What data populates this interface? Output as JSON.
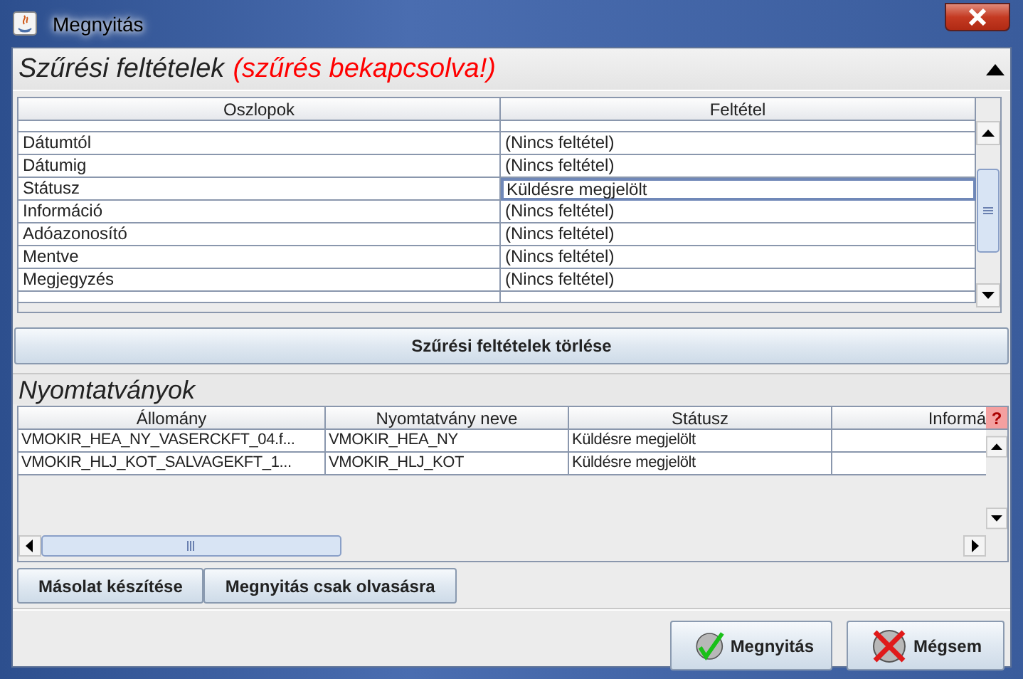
{
  "window": {
    "title": "Megnyitás"
  },
  "filter": {
    "title": "Szűrési feltételek",
    "status": "(szűrés bekapcsolva!)",
    "expanded": true,
    "columns": [
      "Oszlopok",
      "Feltétel"
    ],
    "rows": [
      {
        "column": "Dátumtól",
        "condition": "(Nincs feltétel)",
        "selected": false
      },
      {
        "column": "Dátumig",
        "condition": "(Nincs feltétel)",
        "selected": false
      },
      {
        "column": "Státusz",
        "condition": "Küldésre megjelölt",
        "selected": true
      },
      {
        "column": "Információ",
        "condition": "(Nincs feltétel)",
        "selected": false
      },
      {
        "column": "Adóazonosító",
        "condition": "(Nincs feltétel)",
        "selected": false
      },
      {
        "column": "Mentve",
        "condition": "(Nincs feltétel)",
        "selected": false
      },
      {
        "column": "Megjegyzés",
        "condition": "(Nincs feltétel)",
        "selected": false
      }
    ],
    "clear_button": "Szűrési feltételek törlése"
  },
  "forms": {
    "title": "Nyomtatványok",
    "columns": [
      "Állomány",
      "Nyomtatvány neve",
      "Státusz",
      "Informá"
    ],
    "help": "?",
    "rows": [
      {
        "cells": [
          "VMOKIR_HEA_NY_VASERCKFT_04.f...",
          "VMOKIR_HEA_NY",
          "Küldésre megjelölt"
        ]
      },
      {
        "cells": [
          "VMOKIR_HLJ_KOT_SALVAGEKFT_1...",
          "VMOKIR_HLJ_KOT",
          "Küldésre megjelölt"
        ]
      }
    ]
  },
  "actions": [
    "Másolat készítése",
    "Megnyitás csak olvasásra"
  ],
  "buttons": [
    {
      "label": "Megnyitás",
      "kind": "ok"
    },
    {
      "label": "Mégsem",
      "kind": "cancel"
    }
  ]
}
